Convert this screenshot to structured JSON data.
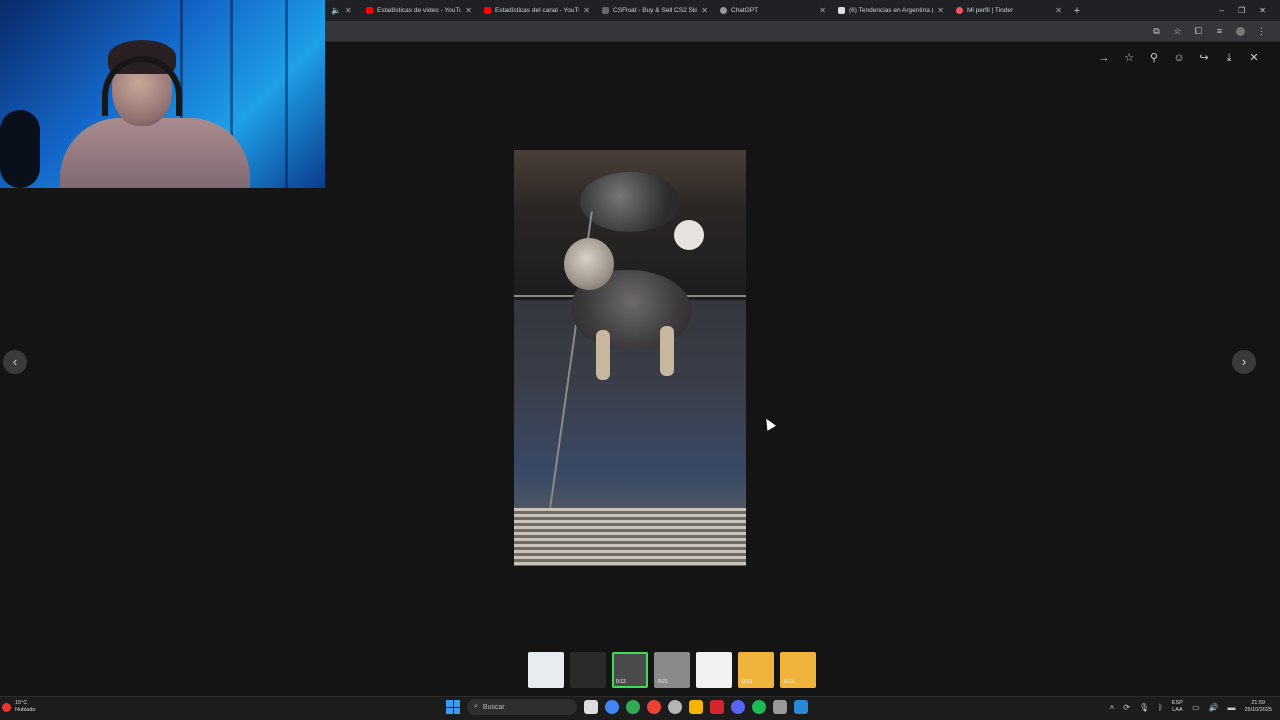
{
  "browser": {
    "tabs": [
      {
        "label": "",
        "favicon_color": "#888888"
      },
      {
        "label": "Estadísticas de vídeo - YouTub",
        "favicon_color": "#ff0000"
      },
      {
        "label": "Estadísticas del canal - YouTub",
        "favicon_color": "#ff0000"
      },
      {
        "label": "CSFloat - Buy & Sell CS2 Skins",
        "favicon_color": "#666666"
      },
      {
        "label": "ChatGPT",
        "favicon_color": "#999999"
      },
      {
        "label": "(6) Tendencias en Argentina (E",
        "favicon_color": "#dddddd"
      },
      {
        "label": "Mi perfil | Tinder",
        "favicon_color": "#fd5068"
      }
    ],
    "new_tab": "+",
    "window_controls": {
      "minimize": "–",
      "maximize": "❐",
      "close": "✕"
    }
  },
  "viewer": {
    "actions": [
      {
        "name": "forward-icon",
        "glyph": "→"
      },
      {
        "name": "star-icon",
        "glyph": "☆"
      },
      {
        "name": "pin-icon",
        "glyph": "⚲"
      },
      {
        "name": "emoji-icon",
        "glyph": "☺"
      },
      {
        "name": "share-icon",
        "glyph": "↪"
      },
      {
        "name": "download-icon",
        "glyph": "⤓"
      },
      {
        "name": "close-icon",
        "glyph": "✕"
      }
    ],
    "prev": "‹",
    "next": "›"
  },
  "thumbnails": [
    {
      "color": "#e9ecef",
      "duration": ""
    },
    {
      "color": "#2a2a2a",
      "duration": ""
    },
    {
      "color": "#4a4a4a",
      "duration": "0:12",
      "active": true
    },
    {
      "color": "#8a8a8a",
      "duration": "0:21"
    },
    {
      "color": "#f1f1f1",
      "duration": ""
    },
    {
      "color": "#f0b43c",
      "duration": "0:23"
    },
    {
      "color": "#f0b43c",
      "duration": "0:13"
    }
  ],
  "taskbar": {
    "weather_temp": "15°C",
    "weather_cond": "Nublado",
    "search_placeholder": "Buscar",
    "apps": [
      "#dddddd",
      "#4285f4",
      "#34a853",
      "#ea4335",
      "#b6b6b6",
      "#f4b400",
      "#d3262c",
      "#5865f2",
      "#1db954",
      "#999999",
      "#2b88d8"
    ],
    "lang_1": "ESP",
    "lang_2": "LAA",
    "time": "21:59",
    "date": "25/10/2025"
  }
}
